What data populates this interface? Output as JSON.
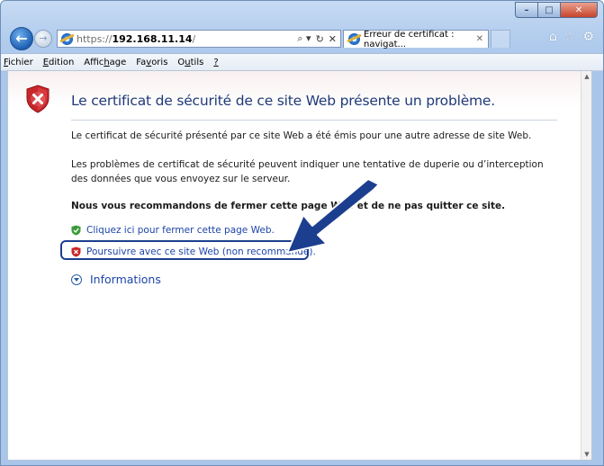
{
  "window": {
    "controls": {
      "minimize": "–",
      "maximize": "□",
      "close": "✕"
    }
  },
  "nav": {
    "back_glyph": "←",
    "forward_glyph": "→",
    "url_scheme": "https://",
    "url_host": "192.168.11.14",
    "url_path": "/",
    "addr_tools": {
      "search": "⌕ ▾",
      "refresh": "↻",
      "stop": "✕"
    },
    "tab_title": "Erreur de certificat : navigat...",
    "tab_close": "✕",
    "right_icons": {
      "home": "⌂",
      "favorites": "☆",
      "tools": "⚙"
    }
  },
  "menubar": {
    "items": [
      {
        "prefix": "",
        "key": "F",
        "rest": "ichier"
      },
      {
        "prefix": "",
        "key": "E",
        "rest": "dition"
      },
      {
        "prefix": "Affic",
        "key": "h",
        "rest": "age"
      },
      {
        "prefix": "Fa",
        "key": "v",
        "rest": "oris"
      },
      {
        "prefix": "O",
        "key": "u",
        "rest": "tils"
      },
      {
        "prefix": "",
        "key": "?",
        "rest": ""
      }
    ]
  },
  "content": {
    "title": "Le certificat de sécurité de ce site Web présente un problème.",
    "p1": "Le certificat de sécurité présenté par ce site Web a été émis pour une autre adresse de site Web.",
    "p2": "Les problèmes de certificat de sécurité peuvent indiquer une tentative de duperie ou d’interception des données que vous envoyez sur le serveur.",
    "recommend": "Nous vous recommandons de fermer cette page Web et de ne pas quitter ce site.",
    "link_close": "Cliquez ici pour fermer cette page Web.",
    "link_continue": "Poursuivre avec ce site Web (non recommandé).",
    "info": "Informations"
  },
  "colors": {
    "title": "#1f3a78",
    "link": "#1d44a8",
    "arrow": "#1c3e8f",
    "shield_red": "#c8262b",
    "shield_green": "#3c9a3c"
  }
}
